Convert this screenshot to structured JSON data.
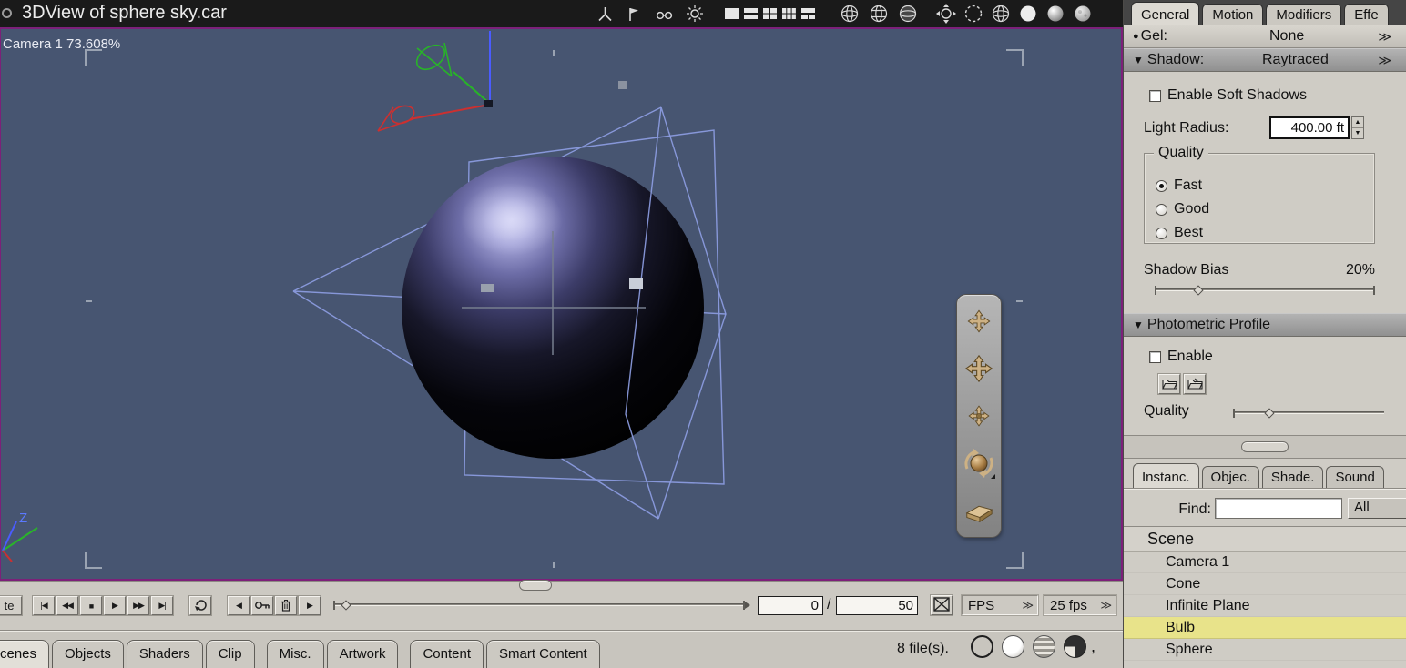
{
  "title_bar": {
    "title": "3DView of sphere sky.car",
    "toolbar_icon_names": [
      "axes-icon",
      "flag-icon",
      "glasses-icon",
      "sun-icon",
      "single-pane-icon",
      "split-horizontal-icon",
      "grid-4-pane-icon",
      "grid-6-pane-icon",
      "mixed-pane-icon",
      "globe-wire-icon",
      "globe-lined-icon",
      "globe-shaded-icon",
      "orbit-camera-icon",
      "dashed-circle-icon",
      "wireframe-sphere-icon",
      "flat-sphere-icon",
      "shaded-sphere-icon",
      "textured-sphere-icon"
    ]
  },
  "viewport": {
    "camera_label": "Camera 1 73.608%",
    "axis_z": "Z",
    "nav_tool_names": [
      "pan-tool-icon",
      "dolly-tool-icon",
      "track-tool-icon",
      "orbit-ball-icon",
      "bank-plane-icon"
    ]
  },
  "right_panel": {
    "tabs": [
      "General",
      "Motion",
      "Modifiers",
      "Effe"
    ],
    "gel": {
      "bullet": "●",
      "label": "Gel:",
      "value": "None",
      "collapse": "≫"
    },
    "shadow": {
      "arrow": "▼",
      "label": "Shadow:",
      "value": "Raytraced",
      "collapse": "≫"
    },
    "soft_shadows_label": "Enable Soft Shadows",
    "light_radius": {
      "label": "Light Radius:",
      "value": "400.00 ft",
      "spin_up": "▲",
      "spin_down": "▼"
    },
    "quality_group": {
      "legend": "Quality",
      "options": [
        "Fast",
        "Good",
        "Best"
      ],
      "selected": "Fast"
    },
    "shadow_bias": {
      "label": "Shadow Bias",
      "value": "20%"
    },
    "photometric": {
      "arrow": "▼",
      "header": "Photometric Profile",
      "enable_label": "Enable",
      "quality_label": "Quality"
    },
    "browser": {
      "tabs": [
        "Instanc.",
        "Objec.",
        "Shade.",
        "Sound"
      ],
      "find_label": "Find:",
      "find_value": "",
      "filter_value": "All",
      "scene_header": "Scene",
      "items": [
        "Camera 1",
        "Cone",
        "Infinite Plane",
        "Bulb",
        "Sphere"
      ],
      "selected_item": "Bulb"
    }
  },
  "timeline": {
    "animate_label": "te",
    "transport": [
      "|◀",
      "◀◀",
      "■",
      "▶",
      "▶▶",
      "▶|"
    ],
    "loop_icon_name": "loop-icon",
    "nav_left": "◀",
    "key_icon_name": "keyframe-key-icon",
    "trash_icon_name": "trash-icon",
    "nav_right": "▶",
    "current_frame": "0",
    "separator": "/",
    "total_frames": "50",
    "no_preview_icon_name": "crossed-box-icon",
    "fps_label": "FPS",
    "fps_value": "25 fps",
    "collapse": "≫"
  },
  "bottom_bar": {
    "tabs": [
      "cenes",
      "Objects",
      "Shaders",
      "Clip",
      "Misc.",
      "Artwork",
      "Content",
      "Smart Content"
    ],
    "active_tab": "cenes",
    "files_label": "8 file(s).",
    "comma": ",",
    "ball_icon_names": [
      "ring-sphere-icon",
      "white-sphere-icon",
      "striped-sphere-icon",
      "quarter-sphere-icon"
    ]
  }
}
